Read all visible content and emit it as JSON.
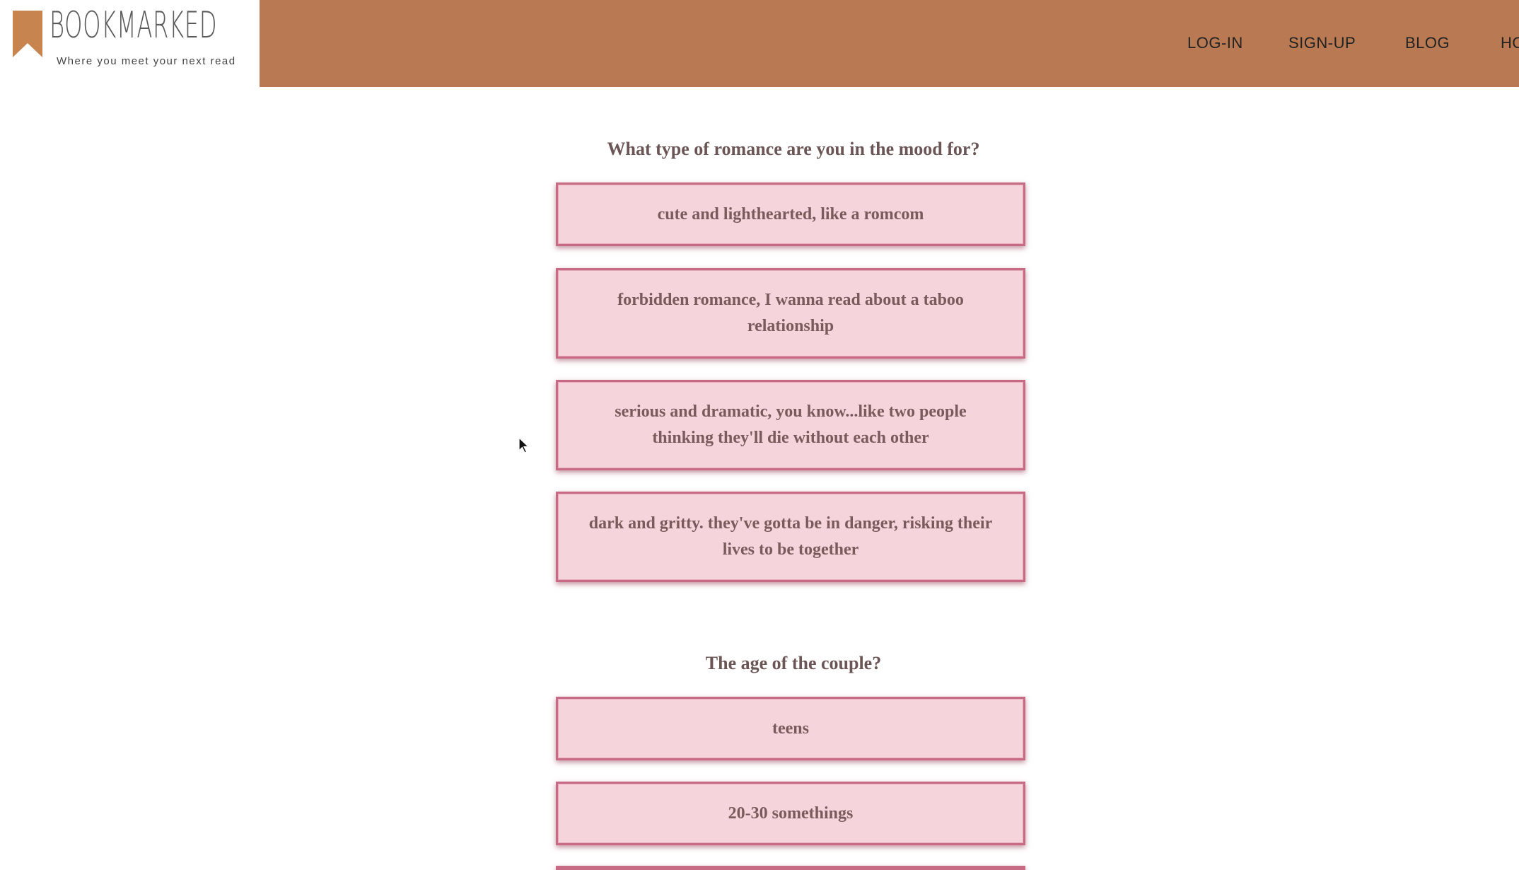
{
  "header": {
    "logo_title": "BOOKMARKED",
    "logo_tagline": "Where you meet your next read",
    "nav": [
      "LOG-IN",
      "SIGN-UP",
      "BLOG",
      "HO"
    ]
  },
  "quiz": {
    "question1": "What type of romance are you in the mood for?",
    "options1": [
      "cute and lighthearted, like a romcom",
      "forbidden romance, I wanna read about a taboo relationship",
      "serious and dramatic, you know...like two people thinking they'll die without each other",
      "dark and gritty. they've gotta be in danger, risking their lives to be together"
    ],
    "question2": "The age of the couple?",
    "options2": [
      "teens",
      "20-30 somethings"
    ]
  },
  "colors": {
    "header": "#b97a53",
    "option_fill": "#f5d4dc",
    "option_border": "#c76b85",
    "logo_mark": "#c8844e"
  },
  "icons": {
    "logo": "bookmark-ribbon-icon",
    "cursor": "mouse-pointer-icon"
  }
}
